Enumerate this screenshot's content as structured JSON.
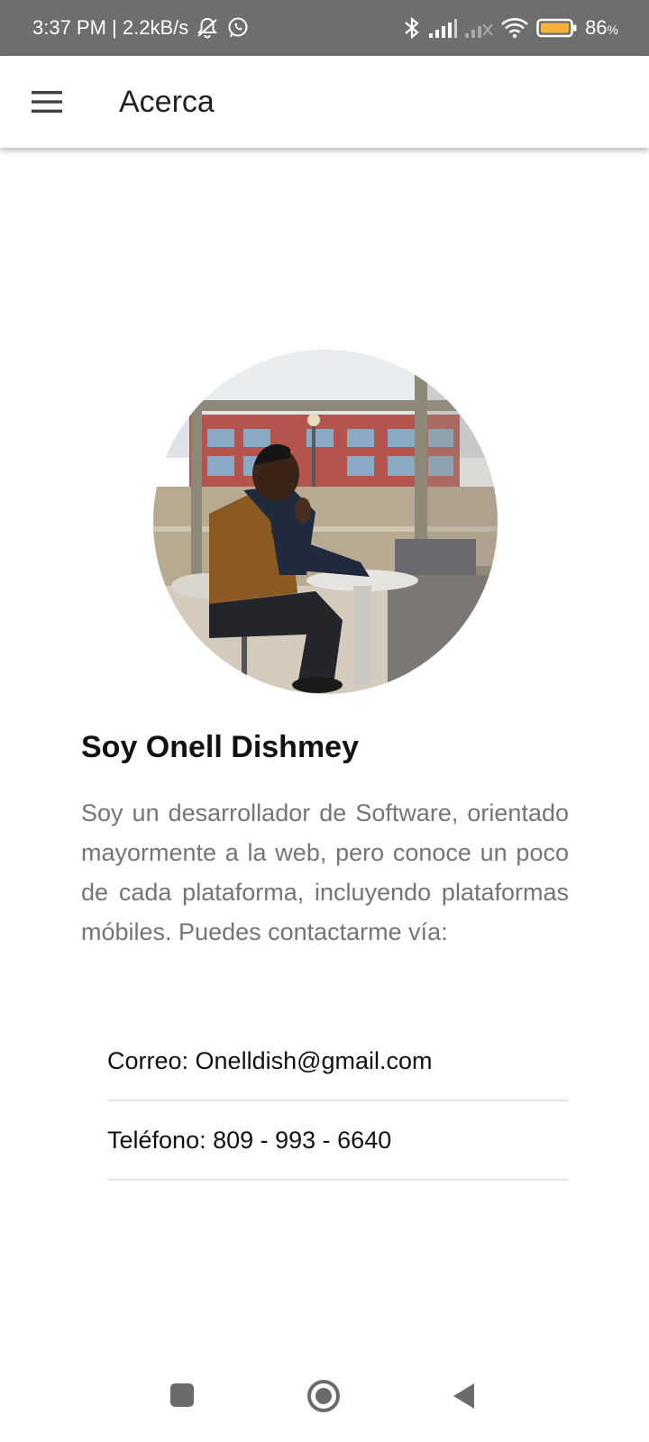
{
  "status_bar": {
    "time_speed": "3:37 PM | 2.2kB/s",
    "battery_percent": "86",
    "battery_unit": "%",
    "icons": [
      "bell-off-icon",
      "whatsapp-icon",
      "bluetooth-icon",
      "signal-icon",
      "signal-off-icon",
      "wifi-icon",
      "battery-icon"
    ]
  },
  "app_bar": {
    "menu_icon": "hamburger-menu-icon",
    "title": "Acerca"
  },
  "profile": {
    "heading": "Soy Onell Dishmey",
    "bio": "Soy un desarrollador de Software, orientado mayormente a la web, pero conoce un poco de cada plataforma, incluyendo plataformas móbiles. Puedes contactarme vía:"
  },
  "contacts": [
    {
      "label": "Correo: Onelldish@gmail.com"
    },
    {
      "label": "Teléfono: 809 - 993 - 6640"
    }
  ],
  "nav_bar": {
    "icons": [
      "recents-square-icon",
      "home-circle-icon",
      "back-triangle-icon"
    ]
  },
  "colors": {
    "status_bar_bg": "#6e6e6e",
    "battery_fill": "#f4b13e",
    "text_primary": "#111111",
    "text_secondary": "#757575",
    "divider": "#e3e3e3"
  }
}
